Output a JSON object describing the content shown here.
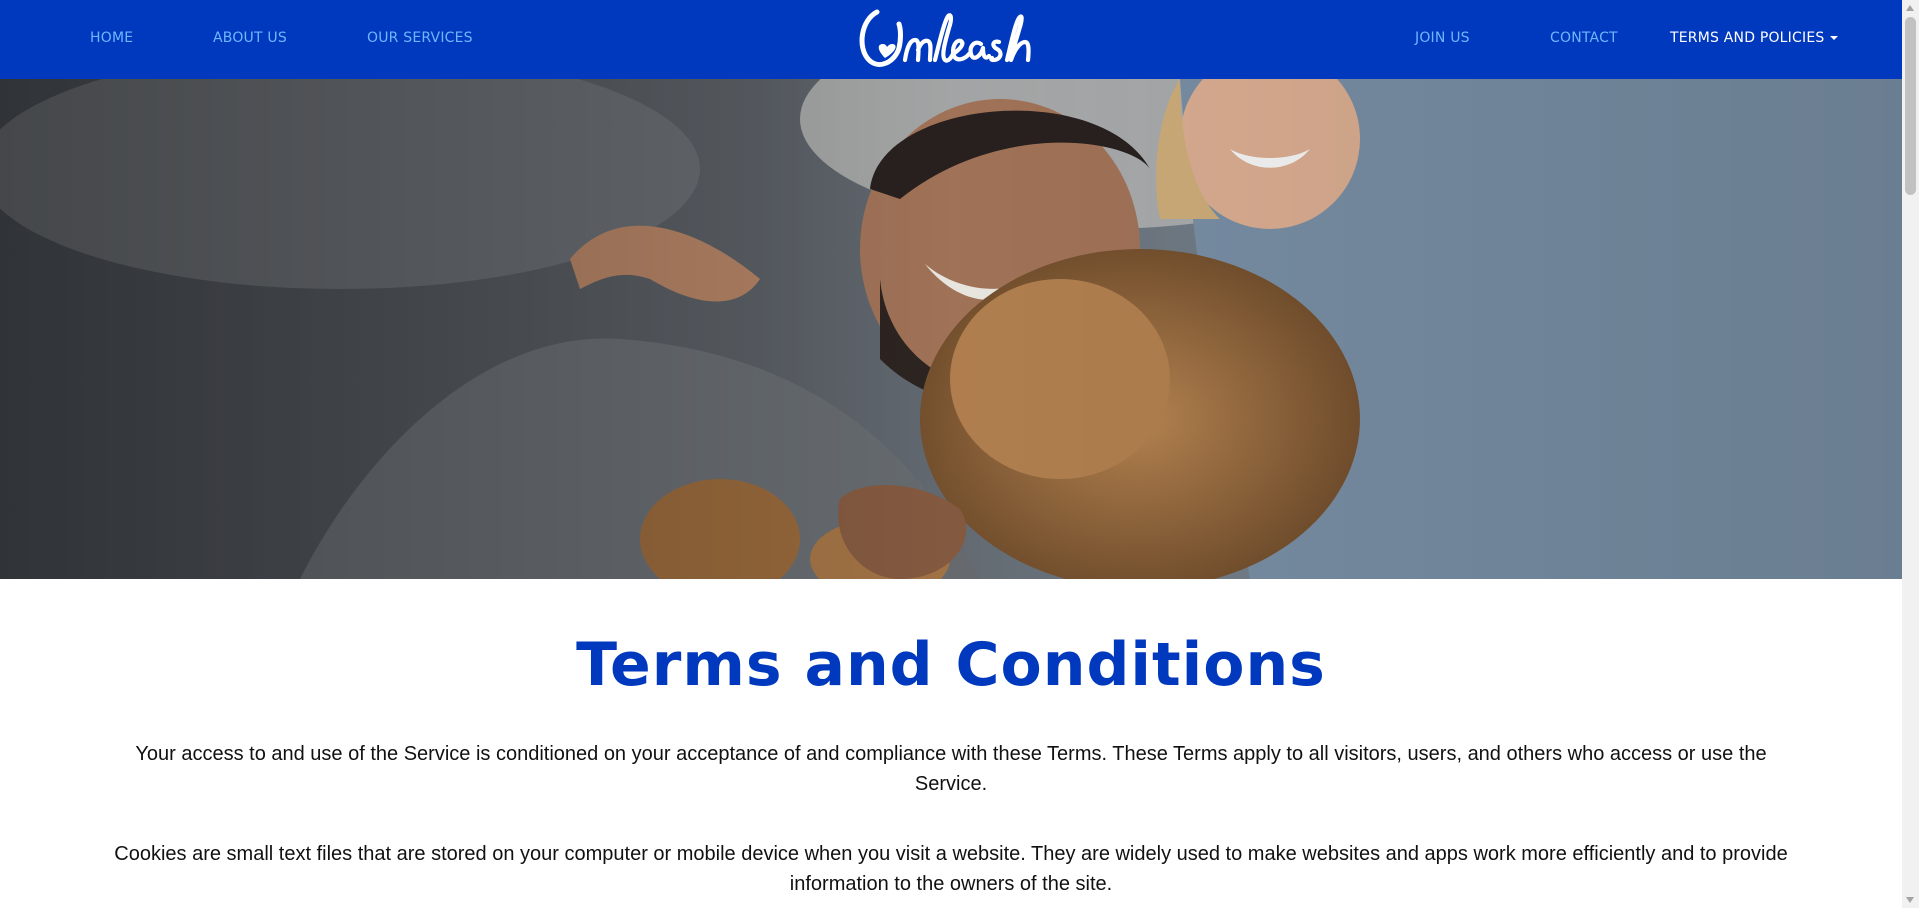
{
  "nav": {
    "left_items": [
      "HOME",
      "ABOUT US",
      "OUR SERVICES"
    ],
    "right_items": [
      "JOIN US",
      "CONTACT"
    ],
    "dropdown_label": "TERMS AND POLICIES",
    "logo_text": "Unleash"
  },
  "colors": {
    "brand_blue": "#0039bd",
    "nav_link": "#6fb6ff",
    "nav_active": "#ffffff"
  },
  "hero": {
    "image": "couple-with-dog-photo"
  },
  "content": {
    "title": "Terms and Conditions",
    "paragraphs": [
      "Your access to and use of the Service is conditioned on your acceptance of and compliance with these Terms. These Terms apply to all visitors, users, and others who access or use the Service.",
      "Cookies are small text files that are stored on your computer or mobile device when you visit a website. They are widely used to make websites and apps work more efficiently and to provide information to the owners of the site."
    ]
  }
}
